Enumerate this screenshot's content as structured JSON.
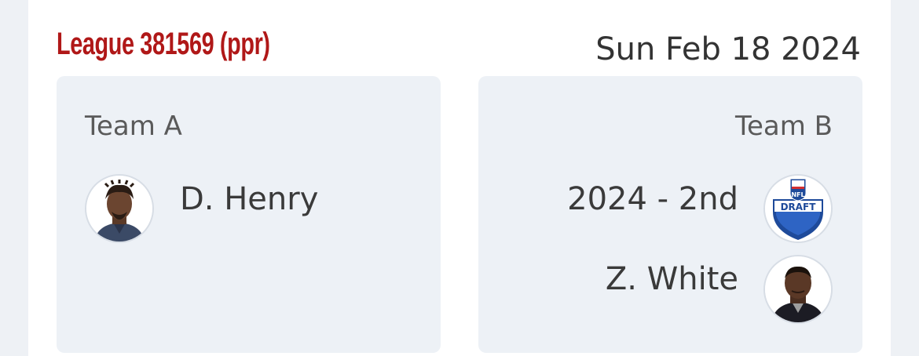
{
  "header": {
    "league": "League 381569 (ppr)",
    "date": "Sun Feb 18 2024"
  },
  "team_a": {
    "name": "Team A",
    "assets": [
      {
        "label": "D. Henry",
        "icon": "player-headshot-icon"
      }
    ]
  },
  "team_b": {
    "name": "Team B",
    "assets": [
      {
        "label": "2024 - 2nd",
        "icon": "nfl-draft-logo-icon",
        "logo_text": "DRAFT"
      },
      {
        "label": "Z. White",
        "icon": "player-headshot-icon"
      }
    ]
  },
  "colors": {
    "accent": "#b01818",
    "panel": "#edf1f6",
    "background": "#eef1f5"
  }
}
